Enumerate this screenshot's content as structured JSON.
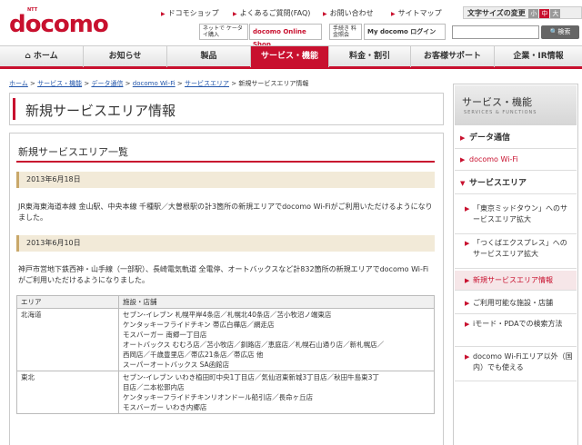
{
  "header": {
    "logo_top": "NTT",
    "logo": "docomo",
    "top_links": [
      "ドコモショップ",
      "よくあるご質問(FAQ)",
      "お問い合わせ",
      "サイトマップ"
    ],
    "text_size_label": "文字サイズの変更",
    "text_sizes": [
      "小",
      "中",
      "大"
    ],
    "banner1": "ネットで ケータイ購入",
    "banner1b": "docomo Online Shop",
    "banner2": "手続き 料金照会",
    "banner3": "My docomo ログイン",
    "search_placeholder": "",
    "search_button": "検索"
  },
  "nav": {
    "items": [
      "ホーム",
      "お知らせ",
      "製品",
      "サービス・機能",
      "料金・割引",
      "お客様サポート",
      "企業・IR情報"
    ]
  },
  "breadcrumb": {
    "items": [
      "ホーム",
      "サービス・機能",
      "データ通信",
      "docomo Wi-Fi",
      "サービスエリア"
    ],
    "current": "新規サービスエリア情報",
    "sep": " > "
  },
  "page": {
    "title": "新規サービスエリア情報",
    "section_title": "新規サービスエリア一覧",
    "entries": [
      {
        "date": "2013年6月18日",
        "text": "JR東海東海道本線 金山駅、中央本線 千種駅／大曽根駅の計3箇所の新規エリアでdocomo Wi-Fiがご利用いただけるようになりました。"
      },
      {
        "date": "2013年6月10日",
        "text": "神戸市営地下鉄西神・山手線（一部駅）、長崎電気軌道 全電停、オートバックスなど計832箇所の新規エリアでdocomo Wi-Fiがご利用いただけるようになりました。"
      }
    ],
    "table": {
      "headers": [
        "エリア",
        "施設・店舗"
      ],
      "rows": [
        {
          "area": "北海道",
          "lines": [
            "セブン-イレブン 札幌平岸4条店／札幌北40条店／苫小牧沼ノ端東店",
            "ケンタッキーフライドチキン 帯広白樺店／網走店",
            "モスバーガー 南郷一丁目店",
            "オートバックス むむろ店／苫小牧店／釧路店／恵庭店／札幌石山通り店／新札幌店／",
            "西岡店／千歳豊里店／帯広21条店／帯広店 他",
            "スーパーオートバックス SA函館店"
          ]
        },
        {
          "area": "東北",
          "lines": [
            "セブン-イレブン いわき植田町中央1丁目店／気仙沼東新城3丁目店／秋田牛島東3丁",
            "目店／二本松郭内店",
            "ケンタッキーフライドチキンリオンドール船引店／長命ヶ丘店",
            "モスバーガー いわき内郷店"
          ]
        }
      ]
    }
  },
  "sidebar": {
    "title": "サービス・機能",
    "subtitle": "SERVICES & FUNCTIONS",
    "items": [
      {
        "label": "データ通信",
        "kind": "cat"
      },
      {
        "label": "docomo Wi-Fi",
        "kind": "link"
      },
      {
        "label": "サービスエリア",
        "kind": "cat"
      },
      {
        "label": "「東京ミッドタウン」へのサービスエリア拡大",
        "kind": "sub"
      },
      {
        "label": "「つくばエクスプレス」へのサービスエリア拡大",
        "kind": "sub"
      },
      {
        "label": "新規サービスエリア情報",
        "kind": "current"
      },
      {
        "label": "ご利用可能な施設・店舗",
        "kind": "sub"
      },
      {
        "label": "iモード・PDAでの検索方法",
        "kind": "sub"
      },
      {
        "label": "docomo Wi-Fiエリア以外（国内）でも使える",
        "kind": "sub"
      }
    ]
  },
  "colors": {
    "brand": "#c8102e",
    "date_bar": "#f2ead8"
  }
}
